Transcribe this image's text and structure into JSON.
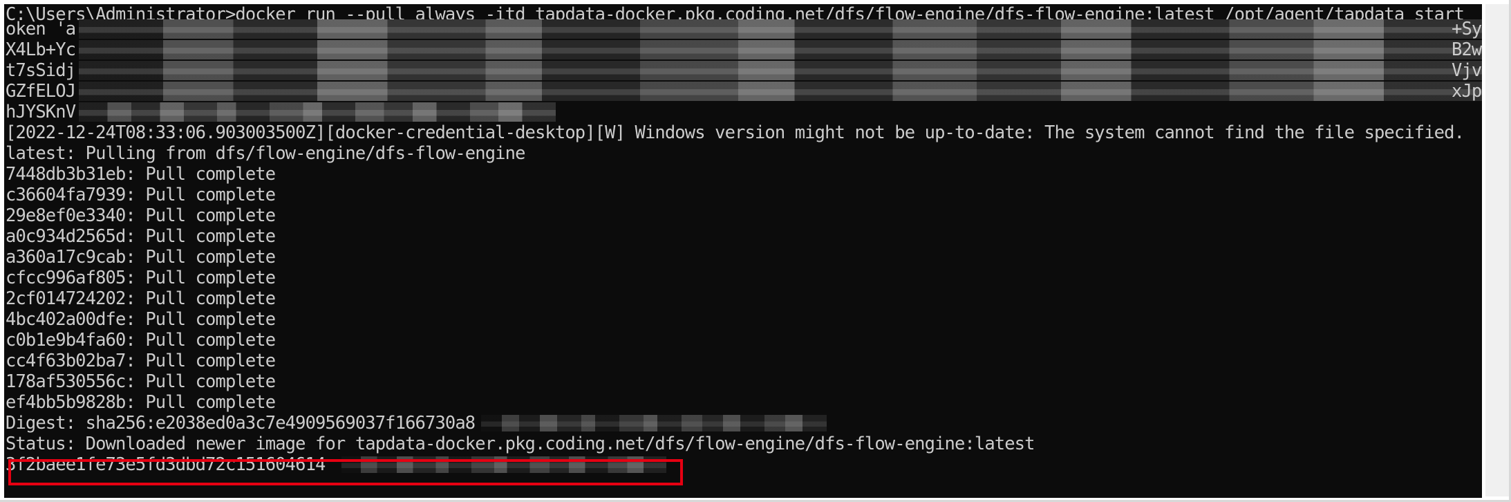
{
  "terminal": {
    "command_line": "C:\\Users\\Administrator>docker run --pull always -itd tapdata-docker.pkg.coding.net/dfs/flow-engine/dfs-flow-engine:latest /opt/agent/tapdata start",
    "token_lines": [
      {
        "prefix": "oken 'a",
        "suffix": "+Sy"
      },
      {
        "prefix": "X4Lb+Yc",
        "suffix": "B2w"
      },
      {
        "prefix": "t7sSidj",
        "suffix": "Vjv"
      },
      {
        "prefix": "GZfELOJ",
        "suffix": "xJp"
      },
      {
        "prefix": "hJYSKnV",
        "suffix": ""
      }
    ],
    "warning_line": "[2022-12-24T08:33:06.903003500Z][docker-credential-desktop][W] Windows version might not be up-to-date: The system cannot find the file specified.",
    "pull_header": "latest: Pulling from dfs/flow-engine/dfs-flow-engine",
    "layers": [
      "7448db3b31eb: Pull complete",
      "c36604fa7939: Pull complete",
      "29e8ef0e3340: Pull complete",
      "a0c934d2565d: Pull complete",
      "a360a17c9cab: Pull complete",
      "cfcc996af805: Pull complete",
      "2cf014724202: Pull complete",
      "4bc402a00dfe: Pull complete",
      "c0b1e9b4fa60: Pull complete",
      "cc4f63b02ba7: Pull complete",
      "178af530556c: Pull complete",
      "ef4bb5b9828b: Pull complete"
    ],
    "digest_line": "Digest: sha256:e2038ed0a3c7e4909569037f166730a8",
    "status_line": "Status: Downloaded newer image for tapdata-docker.pkg.coding.net/dfs/flow-engine/dfs-flow-engine:latest",
    "container_id": "3f2baee1fe73e5fd3dbd72c151604614"
  },
  "colors": {
    "background": "#0c0c0c",
    "text": "#cccccc",
    "highlight_border": "#e60012"
  }
}
